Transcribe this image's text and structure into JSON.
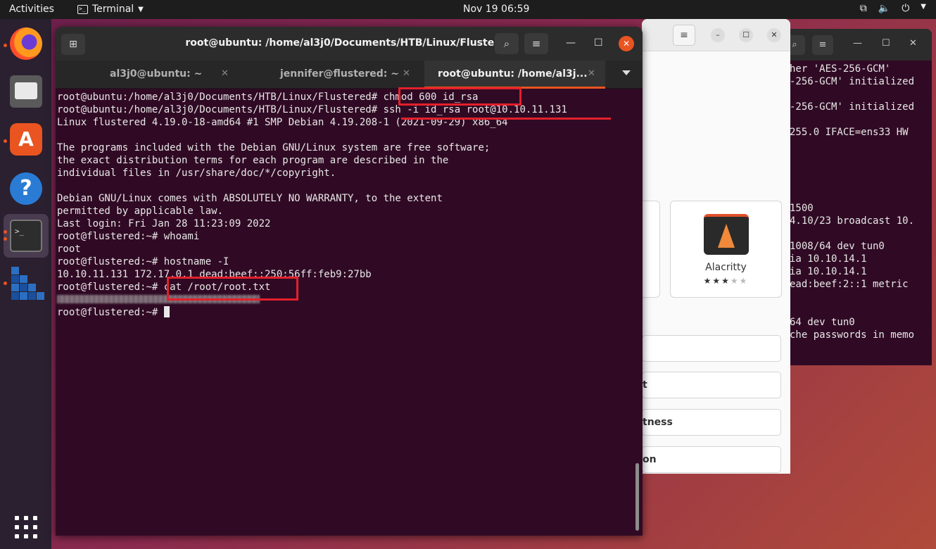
{
  "topbar": {
    "activities": "Activities",
    "app_name": "Terminal",
    "clock": "Nov 19  06:59"
  },
  "dock": {
    "items": [
      "firefox-icon",
      "files-icon",
      "software-icon",
      "help-icon",
      "terminal-icon",
      "vm-icon",
      "show-apps-icon"
    ]
  },
  "main_terminal": {
    "title": "root@ubuntu: /home/al3j0/Documents/HTB/Linux/Flustered",
    "tabs": [
      {
        "label": "al3j0@ubuntu: ~"
      },
      {
        "label": "jennifer@flustered: ~"
      },
      {
        "label": "root@ubuntu: /home/al3j..."
      }
    ],
    "lines": [
      "root@ubuntu:/home/al3j0/Documents/HTB/Linux/Flustered# chmod 600 id_rsa",
      "root@ubuntu:/home/al3j0/Documents/HTB/Linux/Flustered# ssh -i id_rsa root@10.10.11.131",
      "Linux flustered 4.19.0-18-amd64 #1 SMP Debian 4.19.208-1 (2021-09-29) x86_64",
      "",
      "The programs included with the Debian GNU/Linux system are free software;",
      "the exact distribution terms for each program are described in the",
      "individual files in /usr/share/doc/*/copyright.",
      "",
      "Debian GNU/Linux comes with ABSOLUTELY NO WARRANTY, to the extent",
      "permitted by applicable law.",
      "Last login: Fri Jan 28 11:23:09 2022",
      "root@flustered:~# whoami",
      "root",
      "root@flustered:~# hostname -I",
      "10.10.11.131 172.17.0.1 dead:beef::250:56ff:feb9:27bb",
      "root@flustered:~# cat /root/root.txt"
    ],
    "last_prompt": "root@flustered:~# "
  },
  "bg_terminal": {
    "lines": [
      "her 'AES-256-GCM'",
      "-256-GCM' initialized",
      "",
      "-256-GCM' initialized",
      "",
      "255.0 IFACE=ens33 HW",
      "",
      "",
      "",
      "",
      "",
      "1500",
      "4.10/23 broadcast 10.",
      "",
      "1008/64 dev tun0",
      "ia 10.10.14.1",
      "ia 10.10.14.1",
      "ead:beef:2::1 metric",
      "",
      "",
      "64 dev tun0",
      "che passwords in memo"
    ]
  },
  "software_window": {
    "app_name": "Alacritty",
    "rating": "★★★★★",
    "rows": [
      "",
      "t",
      "tness",
      "on"
    ]
  },
  "colors": {
    "terminal_bg": "#300a24",
    "accent": "#e95420",
    "annotation": "#e3202a"
  }
}
